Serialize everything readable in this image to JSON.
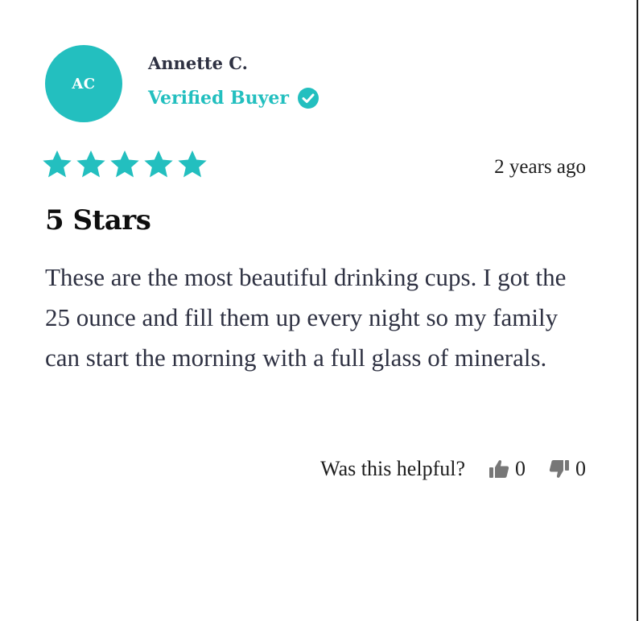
{
  "reviewer": {
    "initials": "AC",
    "name": "Annette C.",
    "verified_label": "Verified Buyer"
  },
  "review": {
    "rating": 5,
    "rating_max": 5,
    "date": "2 years ago",
    "title": "5 Stars",
    "body": "These are the most beautiful drinking cups. I got the 25 ounce and fill them up every night so my family can start the morning with a full glass of minerals."
  },
  "helpful": {
    "label": "Was this helpful?",
    "up_count": "0",
    "down_count": "0"
  },
  "colors": {
    "accent": "#23bfbf",
    "text": "#2e3142",
    "icon_gray": "#777777"
  },
  "icons": {
    "star": "star-icon",
    "verified": "check-circle-icon",
    "thumbs_up": "thumbs-up-icon",
    "thumbs_down": "thumbs-down-icon"
  }
}
